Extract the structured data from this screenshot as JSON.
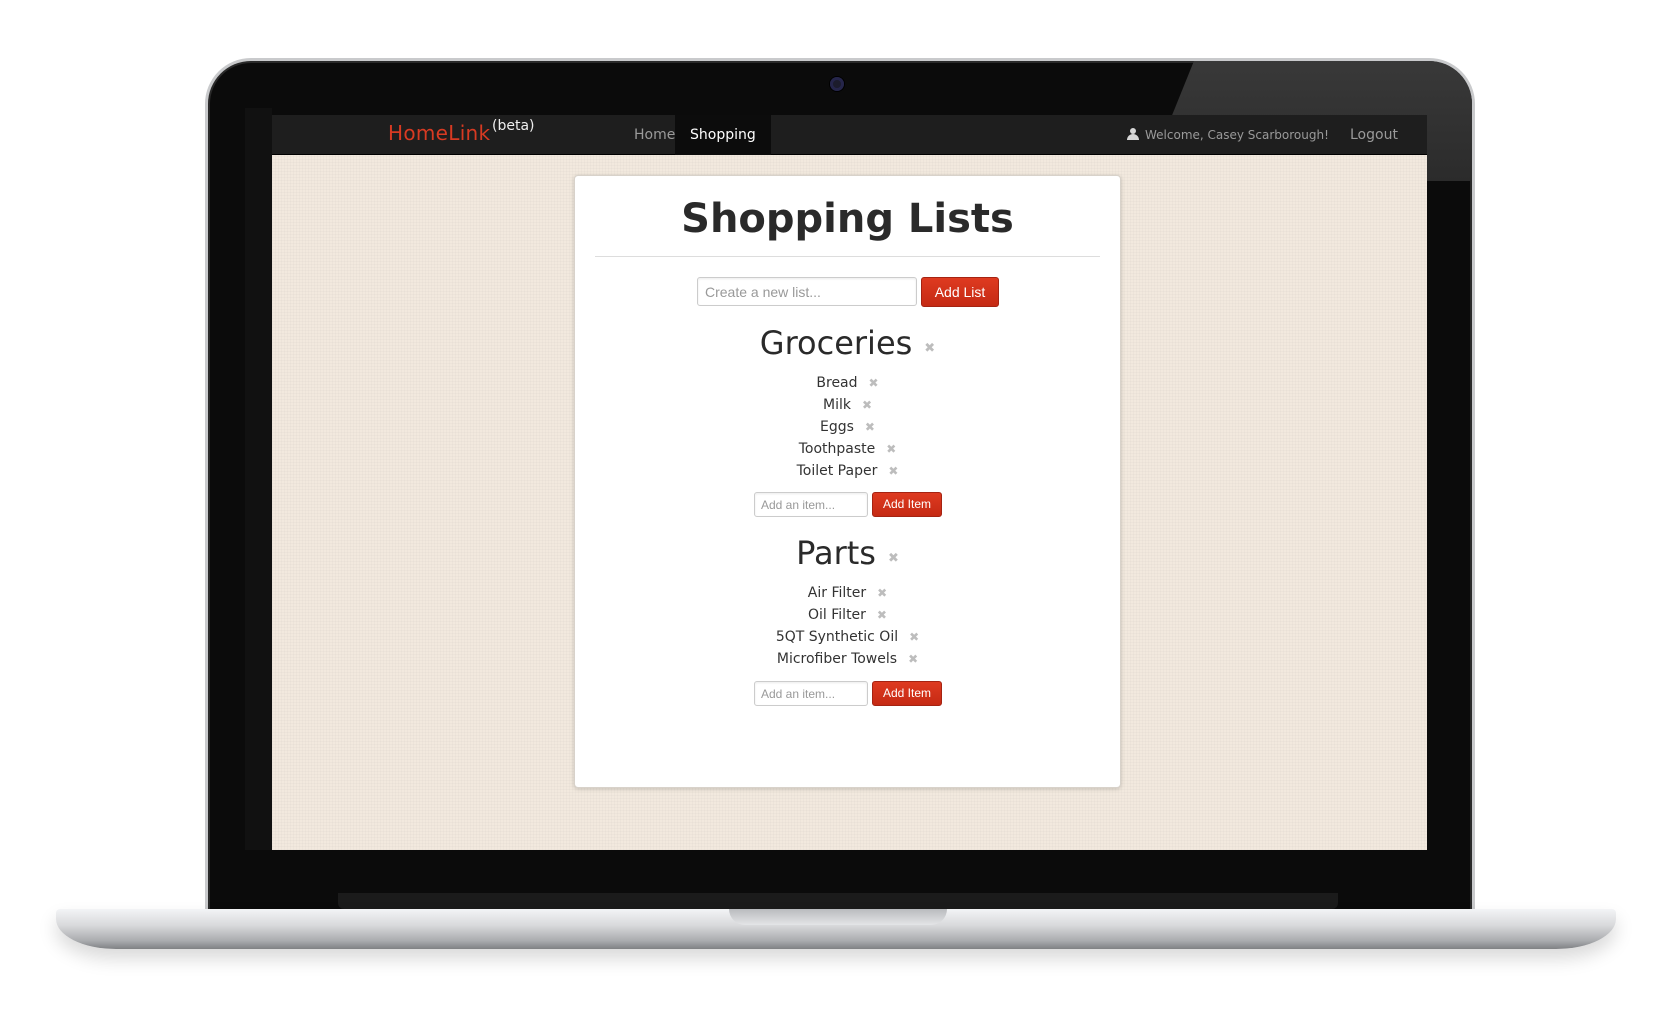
{
  "navbar": {
    "brand": "HomeLink",
    "brand_suffix": "(beta)",
    "items": [
      {
        "label": "Home",
        "active": false
      },
      {
        "label": "Shopping",
        "active": true
      }
    ],
    "welcome": "Welcome, Casey Scarborough!",
    "logout": "Logout"
  },
  "page": {
    "title": "Shopping Lists",
    "new_list_placeholder": "Create a new list...",
    "add_list_label": "Add List"
  },
  "lists": [
    {
      "name": "Groceries",
      "items": [
        "Bread",
        "Milk",
        "Eggs",
        "Toothpaste",
        "Toilet Paper"
      ],
      "item_placeholder": "Add an item...",
      "add_item_label": "Add Item"
    },
    {
      "name": "Parts",
      "items": [
        "Air Filter",
        "Oil Filter",
        "5QT Synthetic Oil",
        "Microfiber Towels"
      ],
      "item_placeholder": "Add an item...",
      "add_item_label": "Add Item"
    }
  ],
  "icons": {
    "remove": "close-icon",
    "user": "user-icon"
  },
  "colors": {
    "brand": "#d73a22",
    "button": "#d0301a",
    "navbar": "#1e1e1e",
    "page_background": "#f2e9de"
  }
}
